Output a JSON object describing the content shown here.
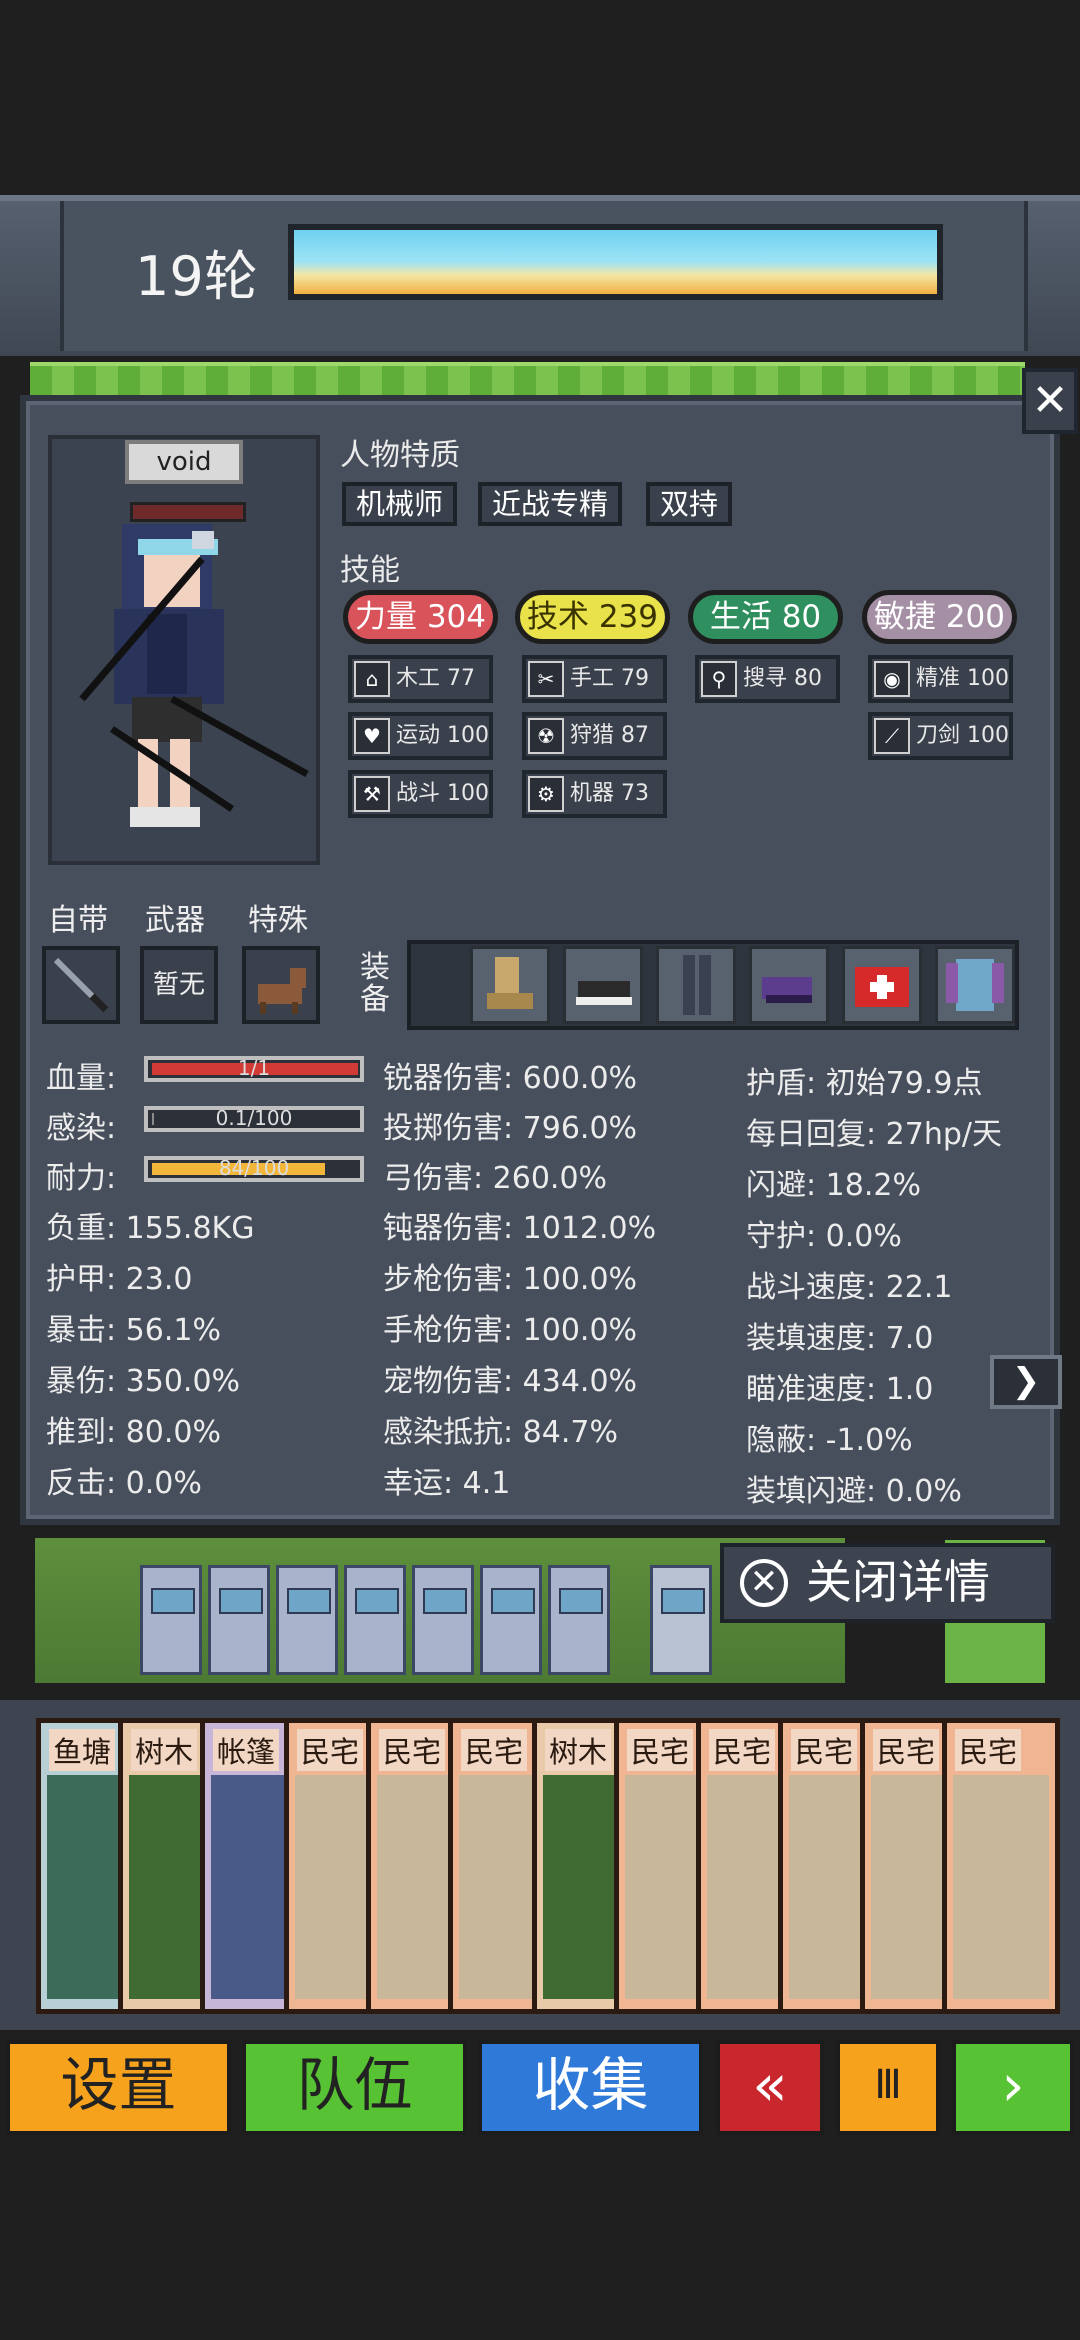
{
  "header": {
    "round_label": "19轮"
  },
  "panel": {
    "character_name": "void",
    "traits_title": "人物特质",
    "traits": [
      "机械师",
      "近战专精",
      "双持"
    ],
    "skills_title": "技能",
    "skill_groups": [
      {
        "label": "力量 304",
        "color": "#d9535b"
      },
      {
        "label": "技术 239",
        "color": "#e9e24a"
      },
      {
        "label": "生活 80",
        "color": "#2f8f5e"
      },
      {
        "label": "敏捷 200",
        "color": "#a48fa5"
      }
    ],
    "subskills": {
      "strength": [
        {
          "icon": "house-icon",
          "glyph": "⌂",
          "label": "木工 77"
        },
        {
          "icon": "heart-icon",
          "glyph": "♥",
          "label": "运动 100"
        },
        {
          "icon": "hammer-icon",
          "glyph": "⚒",
          "label": "战斗 100"
        }
      ],
      "technique": [
        {
          "icon": "scissors-icon",
          "glyph": "✂",
          "label": "手工 79"
        },
        {
          "icon": "radiation-icon",
          "glyph": "☢",
          "label": "狩猎 87"
        },
        {
          "icon": "gear-icon",
          "glyph": "⚙",
          "label": "机器 73"
        }
      ],
      "life": [
        {
          "icon": "magnifier-icon",
          "glyph": "⚲",
          "label": "搜寻 80"
        }
      ],
      "agility": [
        {
          "icon": "eye-icon",
          "glyph": "◉",
          "label": "精准 100"
        },
        {
          "icon": "sword-icon",
          "glyph": "⟋",
          "label": "刀剑 100"
        }
      ]
    },
    "slots": {
      "innate_label": "自带",
      "weapon_label": "武器",
      "special_label": "特殊",
      "weapon_value": "暂无",
      "equip_label": "装备"
    },
    "stats_left": [
      {
        "label": "血量:",
        "bar_value": "1/1",
        "fill": 1.0,
        "color": "#d23a36"
      },
      {
        "label": "感染:",
        "bar_value": "0.1/100",
        "fill": 0.001,
        "color": "#8a8a8a"
      },
      {
        "label": "耐力:",
        "bar_value": "84/100",
        "fill": 0.84,
        "color": "#f2b63a"
      }
    ],
    "stats_left_text": [
      "负重: 155.8KG",
      "护甲: 23.0",
      "暴击: 56.1%",
      "暴伤: 350.0%",
      "推到: 80.0%",
      "反击: 0.0%"
    ],
    "stats_mid": [
      "锐器伤害: 600.0%",
      "投掷伤害: 796.0%",
      "弓伤害: 260.0%",
      "钝器伤害: 1012.0%",
      "步枪伤害: 100.0%",
      "手枪伤害: 100.0%",
      "宠物伤害: 434.0%",
      "感染抵抗: 84.7%",
      "幸运: 4.1"
    ],
    "stats_right": [
      "护盾: 初始79.9点",
      "每日回复: 27hp/天",
      "闪避: 18.2%",
      "守护: 0.0%",
      "战斗速度: 22.1",
      "装填速度: 7.0",
      "瞄准速度: 1.0",
      "隐蔽: -1.0%",
      "装填闪避: 0.0%"
    ]
  },
  "close_detail_label": "关闭详情",
  "cards": [
    {
      "label": "鱼塘",
      "frame": "#b7d0d6",
      "art": "#3d6b5a"
    },
    {
      "label": "树木",
      "frame": "#e8c9a8",
      "art": "#3f6b33"
    },
    {
      "label": "帐篷",
      "frame": "#c7b6d8",
      "art": "#4a5a88"
    },
    {
      "label": "民宅",
      "frame": "#f0b592",
      "art": "#c9b79a"
    },
    {
      "label": "民宅",
      "frame": "#f0b592",
      "art": "#c9b79a"
    },
    {
      "label": "民宅",
      "frame": "#f0b592",
      "art": "#c9b79a"
    },
    {
      "label": "树木",
      "frame": "#e8c9a8",
      "art": "#3f6b33"
    },
    {
      "label": "民宅",
      "frame": "#f0b592",
      "art": "#c9b79a"
    },
    {
      "label": "民宅",
      "frame": "#f0b592",
      "art": "#c9b79a"
    },
    {
      "label": "民宅",
      "frame": "#f0b592",
      "art": "#c9b79a"
    },
    {
      "label": "民宅",
      "frame": "#f0b592",
      "art": "#c9b79a"
    },
    {
      "label": "民宅",
      "frame": "#f0b592",
      "art": "#c9b79a"
    }
  ],
  "bottom_bar": {
    "settings": "设置",
    "team": "队伍",
    "collection": "收集",
    "rewind": "«",
    "pause": "Ⅲ",
    "play": "›"
  }
}
